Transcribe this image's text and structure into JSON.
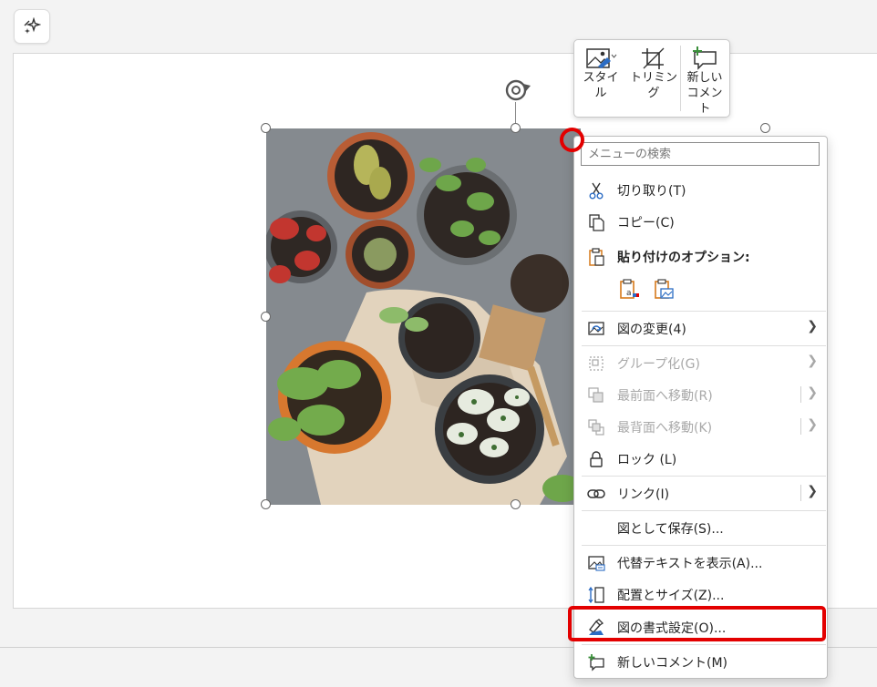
{
  "mini_toolbar": {
    "style_label": "スタイル",
    "trim_label": "トリミング",
    "comment_label": "新しいコメント"
  },
  "context_menu": {
    "search_placeholder": "メニューの検索",
    "cut": "切り取り(T)",
    "copy": "コピー(C)",
    "paste_options": "貼り付けのオプション:",
    "change_picture": "図の変更(4)",
    "group": "グループ化(G)",
    "bring_front": "最前面へ移動(R)",
    "send_back": "最背面へ移動(K)",
    "lock": "ロック (L)",
    "link": "リンク(I)",
    "save_as_picture": "図として保存(S)...",
    "alt_text": "代替テキストを表示(A)...",
    "size_position": "配置とサイズ(Z)...",
    "format_picture": "図の書式設定(O)...",
    "new_comment": "新しいコメント(M)"
  },
  "colors": {
    "highlight": "#e30000",
    "accent_green": "#3a8f3a",
    "accent_orange": "#d67a1c",
    "accent_blue": "#2b6cc4"
  }
}
